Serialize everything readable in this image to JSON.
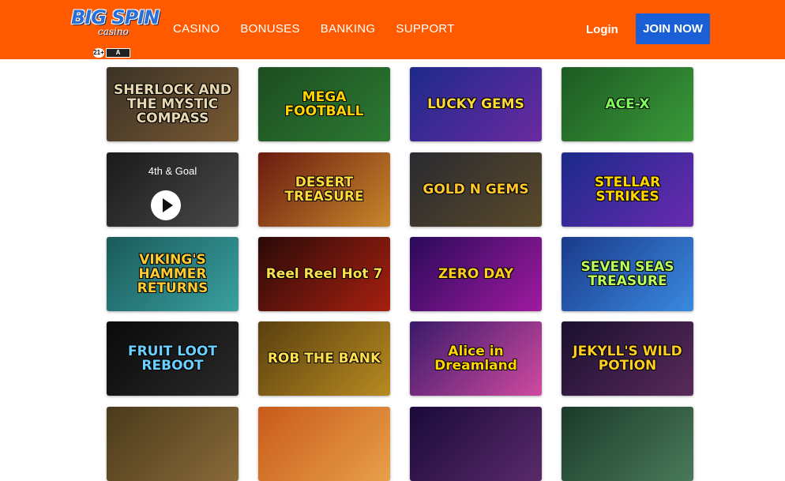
{
  "header": {
    "logo_text": "BIG SPIN",
    "logo_sub": "casino",
    "age_badge": "21+",
    "nav": [
      "CASINO",
      "BONUSES",
      "BANKING",
      "SUPPORT"
    ],
    "login_label": "Login",
    "join_label": "JOIN NOW"
  },
  "games": [
    {
      "title": "SHERLOCK AND THE MYSTIC COMPASS",
      "bg": "#3b3226",
      "bg2": "#7a5a33",
      "color": "#e8d8b0"
    },
    {
      "title": "MEGA FOOTBALL",
      "bg": "#1d4d20",
      "bg2": "#2c7a33",
      "color": "#ffd400"
    },
    {
      "title": "LUCKY GEMS",
      "bg": "#1d2a8a",
      "bg2": "#6a2aa0",
      "color": "#ffd93a"
    },
    {
      "title": "ACE-X",
      "bg": "#1d5a22",
      "bg2": "#3a9a3a",
      "color": "#7cff5a"
    },
    {
      "title": "4th & Goal",
      "bg": "#1a1a1a",
      "bg2": "#4a4a4a",
      "color": "#ffffff",
      "video": true
    },
    {
      "title": "DESERT TREASURE",
      "bg": "#6a1a10",
      "bg2": "#c9872a",
      "color": "#ffd83a"
    },
    {
      "title": "GOLD N GEMS",
      "bg": "#2a2a30",
      "bg2": "#5a4a2a",
      "color": "#ffc82a"
    },
    {
      "title": "STELLAR STRIKES",
      "bg": "#1a2a8a",
      "bg2": "#6a2ab0",
      "color": "#ffd400"
    },
    {
      "title": "VIKING'S HAMMER RETURNS",
      "bg": "#1a5a5a",
      "bg2": "#3aa0a0",
      "color": "#ffcc33"
    },
    {
      "title": "Reel Reel Hot 7",
      "bg": "#2a0a08",
      "bg2": "#a82010",
      "color": "#ffe04a"
    },
    {
      "title": "ZERO DAY",
      "bg": "#2a0a5a",
      "bg2": "#a01aa0",
      "color": "#ffcc22"
    },
    {
      "title": "SEVEN SEAS TREASURE",
      "bg": "#1a3a8a",
      "bg2": "#3a8ae0",
      "color": "#b8ff5a"
    },
    {
      "title": "FRUIT LOOT REBOOT",
      "bg": "#0a0a0a",
      "bg2": "#2a2a2a",
      "color": "#6ad0ff"
    },
    {
      "title": "ROB THE BANK",
      "bg": "#5a4010",
      "bg2": "#b88a20",
      "color": "#ffe04a"
    },
    {
      "title": "Alice in Dreamland",
      "bg": "#3a1a6a",
      "bg2": "#d04aa0",
      "color": "#ffd400"
    },
    {
      "title": "JEKYLL'S WILD POTION",
      "bg": "#1a1030",
      "bg2": "#5a2a5a",
      "color": "#ffcc22"
    },
    {
      "title": "",
      "bg": "#4a3a1a",
      "bg2": "#8a6a3a",
      "color": "#ffffff"
    },
    {
      "title": "",
      "bg": "#c85a1a",
      "bg2": "#e8a04a",
      "color": "#ffffff"
    },
    {
      "title": "",
      "bg": "#1a0a3a",
      "bg2": "#5a2a6a",
      "color": "#ffffff"
    },
    {
      "title": "",
      "bg": "#1a3a2a",
      "bg2": "#4a7a5a",
      "color": "#ffffff"
    }
  ],
  "colors": {
    "header_bg": "#ff5a00",
    "join_bg": "#1a5fd6"
  }
}
